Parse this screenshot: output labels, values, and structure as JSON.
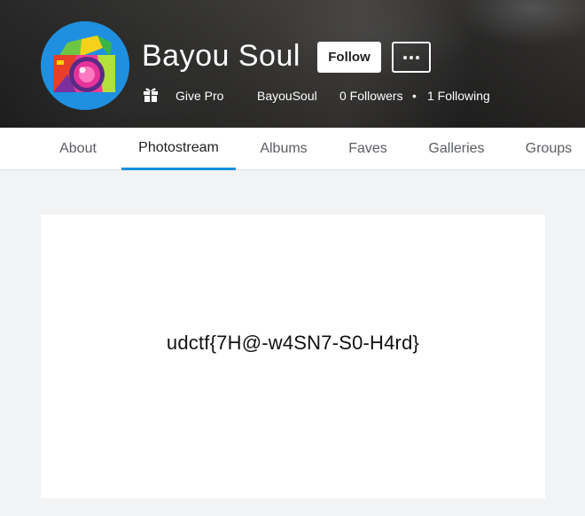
{
  "profile": {
    "name": "Bayou Soul",
    "follow_label": "Follow",
    "more_icon": "ellipsis-icon",
    "avatar_icon": "camera-icon",
    "give_pro_icon": "gift-icon",
    "give_pro_label": "Give Pro",
    "username": "BayouSoul",
    "followers": "0 Followers",
    "separator": "•",
    "following": "1 Following"
  },
  "tabs": [
    {
      "label": "About"
    },
    {
      "label": "Photostream"
    },
    {
      "label": "Albums"
    },
    {
      "label": "Faves"
    },
    {
      "label": "Galleries"
    },
    {
      "label": "Groups"
    }
  ],
  "active_tab": "Photostream",
  "photo": {
    "text": "udctf{7H@-w4SN7-S0-H4rd}"
  },
  "colors": {
    "accent": "#128fdc",
    "avatar_bg": "#1f8fe0"
  }
}
